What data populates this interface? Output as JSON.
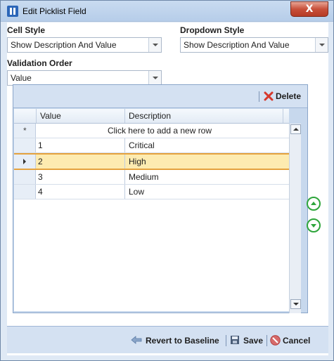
{
  "window": {
    "title": "Edit Picklist Field",
    "close_glyph": "X"
  },
  "form": {
    "cell_style": {
      "label": "Cell Style",
      "value": "Show Description And Value"
    },
    "dropdown_style": {
      "label": "Dropdown Style",
      "value": "Show Description And Value"
    },
    "validation_order": {
      "label": "Validation Order",
      "value": "Value"
    }
  },
  "toolbar": {
    "delete_label": "Delete",
    "delete_icon": "delete-x-icon",
    "delete_color": "#d6382c"
  },
  "grid": {
    "columns": [
      "Value",
      "Description"
    ],
    "new_row_text": "Click here to add a new row",
    "new_row_marker": "*",
    "rows": [
      {
        "value": "1",
        "description": "Critical"
      },
      {
        "value": "2",
        "description": "High"
      },
      {
        "value": "3",
        "description": "Medium"
      },
      {
        "value": "4",
        "description": "Low"
      }
    ],
    "selected_row_index": 1
  },
  "footer": {
    "revert_label": "Revert to Baseline",
    "save_label": "Save",
    "cancel_label": "Cancel"
  },
  "colors": {
    "accent": "#2ea53b",
    "selection": "#fdebb0",
    "selection_border": "#e5a23e"
  }
}
